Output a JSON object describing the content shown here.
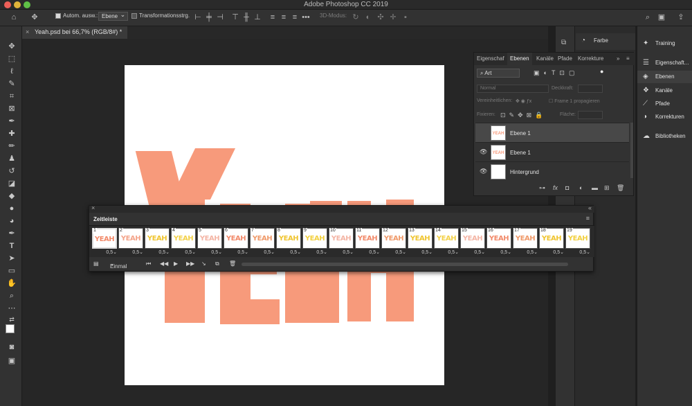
{
  "app": {
    "title": "Adobe Photoshop CC 2019"
  },
  "options_bar": {
    "auto_select_label": "Autom. ausw.:",
    "auto_select_value": "Ebene",
    "transform_label": "Transformationsstrg.",
    "mode_3d": "3D-Modus:"
  },
  "document": {
    "tab_label": "Yeah.psd bei 66,7% (RGB/8#) *"
  },
  "dock": {
    "color_label": "Farbe"
  },
  "panel_column": {
    "items": [
      {
        "label": "Training",
        "icon": "lightbulb-icon"
      },
      {
        "label": "Eigenschaft...",
        "icon": "properties-icon"
      },
      {
        "label": "Ebenen",
        "icon": "layers-icon"
      },
      {
        "label": "Kanäle",
        "icon": "channels-icon"
      },
      {
        "label": "Pfade",
        "icon": "paths-icon"
      },
      {
        "label": "Korrekturen",
        "icon": "adjustments-icon"
      },
      {
        "label": "Bibliotheken",
        "icon": "libraries-icon"
      }
    ]
  },
  "layers_panel": {
    "tabs": [
      "Eigenschaf",
      "Ebenen",
      "Kanäle",
      "Pfade",
      "Korrekture"
    ],
    "filter_value": "Art",
    "blend_mode": "Normal",
    "opacity_label": "Deckkraft:",
    "unify_label": "Vereinheitlichen:",
    "propagate_label": "Frame 1 propagieren",
    "lock_label": "Fixieren:",
    "fill_label": "Fläche:",
    "layers": [
      {
        "name": "Ebene 1",
        "visible": false,
        "selected": true,
        "thumb": "YEAH"
      },
      {
        "name": "Ebene 1",
        "visible": true,
        "selected": false,
        "thumb": "YEAH"
      },
      {
        "name": "Hintergrund",
        "visible": true,
        "selected": false,
        "thumb": ""
      }
    ]
  },
  "timeline": {
    "tab_label": "Zeitleiste",
    "loop_value": "Einmal",
    "frames": [
      {
        "n": "1",
        "delay": "0,5",
        "color": "#f28a6a"
      },
      {
        "n": "2",
        "delay": "0,5",
        "color": "#f4a48a"
      },
      {
        "n": "3",
        "delay": "0,5",
        "color": "#f0c530"
      },
      {
        "n": "4",
        "delay": "0,5",
        "color": "#f3d14a"
      },
      {
        "n": "5",
        "delay": "0,5",
        "color": "#f4b5a5"
      },
      {
        "n": "6",
        "delay": "0,5",
        "color": "#f28a6a"
      },
      {
        "n": "7",
        "delay": "0,5",
        "color": "#f09a6a"
      },
      {
        "n": "8",
        "delay": "0,5",
        "color": "#f0c530"
      },
      {
        "n": "9",
        "delay": "0,5",
        "color": "#f2d040"
      },
      {
        "n": "10",
        "delay": "0,5",
        "color": "#f4b5a5"
      },
      {
        "n": "11",
        "delay": "0,5",
        "color": "#f28a6a"
      },
      {
        "n": "12",
        "delay": "0,5",
        "color": "#f09a6a"
      },
      {
        "n": "13",
        "delay": "0,5",
        "color": "#f0c530"
      },
      {
        "n": "14",
        "delay": "0,5",
        "color": "#f3d14a"
      },
      {
        "n": "15",
        "delay": "0,5",
        "color": "#f4b5a5"
      },
      {
        "n": "16",
        "delay": "0,5",
        "color": "#f28a6a"
      },
      {
        "n": "17",
        "delay": "0,5",
        "color": "#f09a6a"
      },
      {
        "n": "18",
        "delay": "0,5",
        "color": "#f0c530"
      },
      {
        "n": "19",
        "delay": "0,5",
        "color": "#f2d040"
      }
    ],
    "frame_text": "YEAH"
  },
  "colors": {
    "artwork": "#f79a7b"
  }
}
